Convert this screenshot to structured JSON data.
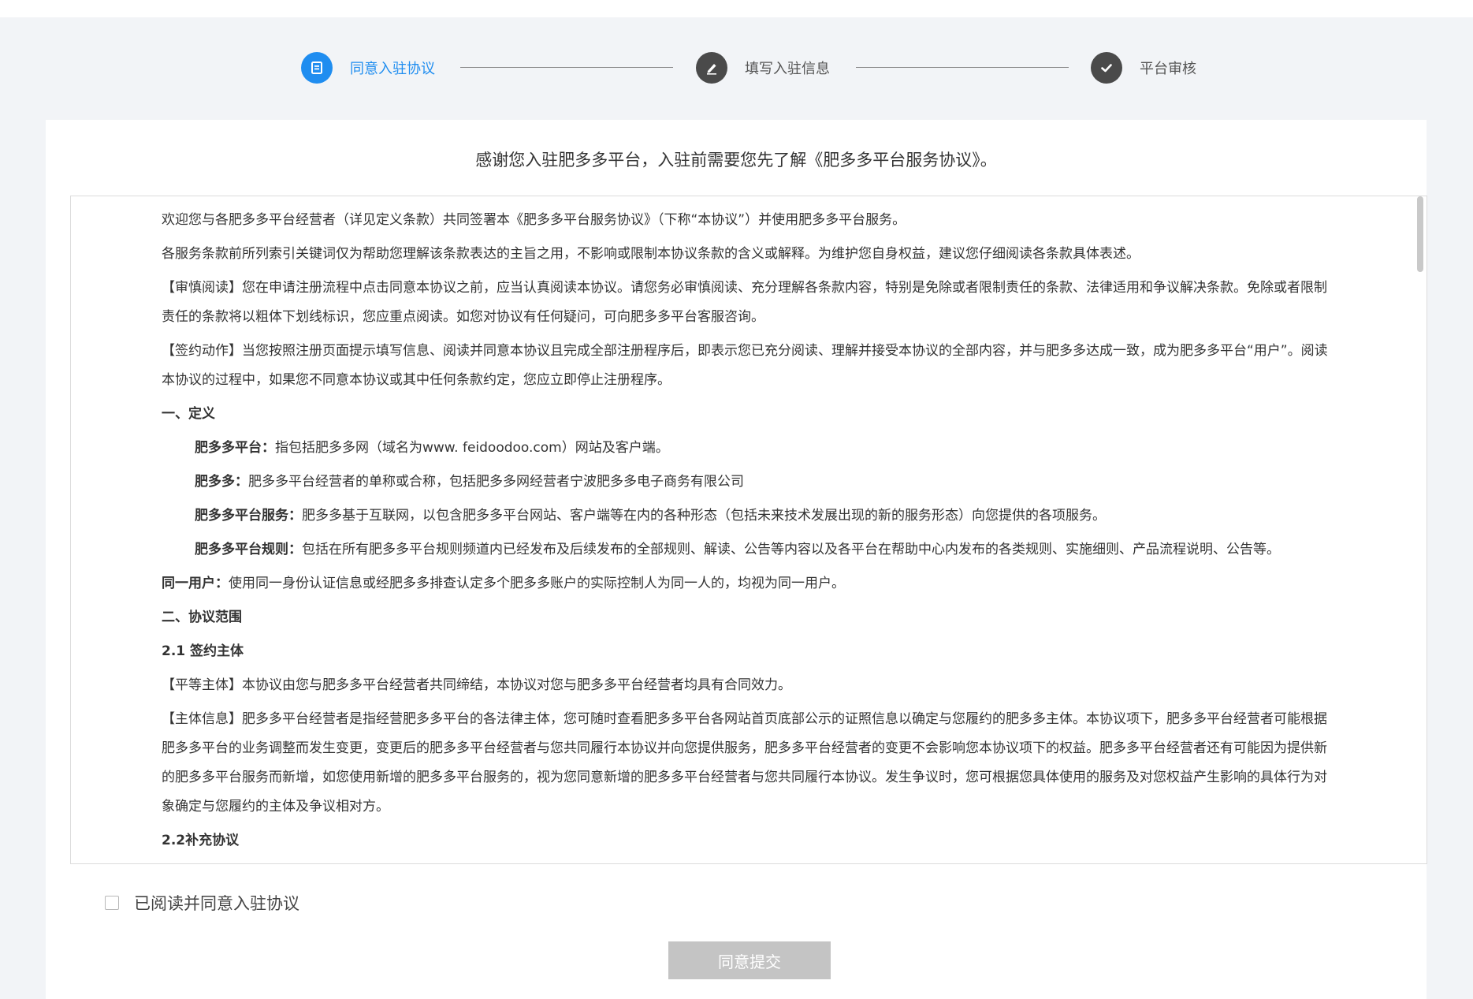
{
  "steps": [
    {
      "label": "同意入驻协议",
      "icon": "document-icon",
      "active": true
    },
    {
      "label": "填写入驻信息",
      "icon": "pencil-icon",
      "active": false
    },
    {
      "label": "平台审核",
      "icon": "check-icon",
      "active": false
    }
  ],
  "colors": {
    "accent": "#1f8df0",
    "inactive_step": "#4a4a4a",
    "button_disabled": "#c4c4c4",
    "background": "#f2f4f7"
  },
  "card": {
    "title": "感谢您入驻肥多多平台，入驻前需要您先了解《肥多多平台服务协议》。"
  },
  "agreement": {
    "p1": "欢迎您与各肥多多平台经营者（详见定义条款）共同签署本《肥多多平台服务协议》（下称“本协议”）并使用肥多多平台服务。",
    "p2": "各服务条款前所列索引关键词仅为帮助您理解该条款表达的主旨之用，不影响或限制本协议条款的含义或解释。为维护您自身权益，建议您仔细阅读各条款具体表述。",
    "p3": "【审慎阅读】您在申请注册流程中点击同意本协议之前，应当认真阅读本协议。请您务必审慎阅读、充分理解各条款内容，特别是免除或者限制责任的条款、法律适用和争议解决条款。免除或者限制责任的条款将以粗体下划线标识，您应重点阅读。如您对协议有任何疑问，可向肥多多平台客服咨询。",
    "p4": "【签约动作】当您按照注册页面提示填写信息、阅读并同意本协议且完成全部注册程序后，即表示您已充分阅读、理解并接受本协议的全部内容，并与肥多多达成一致，成为肥多多平台“用户”。阅读本协议的过程中，如果您不同意本协议或其中任何条款约定，您应立即停止注册程序。",
    "h1": "一、定义",
    "d1_term": "肥多多平台：",
    "d1_text": "指包括肥多多网（域名为www. feidoodoo.com）网站及客户端。",
    "d2_term": "肥多多：",
    "d2_text": "肥多多平台经营者的单称或合称，包括肥多多网经营者宁波肥多多电子商务有限公司",
    "d3_term": "肥多多平台服务：",
    "d3_text": "肥多多基于互联网，以包含肥多多平台网站、客户端等在内的各种形态（包括未来技术发展出现的新的服务形态）向您提供的各项服务。",
    "d4_term": "肥多多平台规则：",
    "d4_text": "包括在所有肥多多平台规则频道内已经发布及后续发布的全部规则、解读、公告等内容以及各平台在帮助中心内发布的各类规则、实施细则、产品流程说明、公告等。",
    "d5_term": "同一用户：",
    "d5_text": "使用同一身份认证信息或经肥多多排查认定多个肥多多账户的实际控制人为同一人的，均视为同一用户。",
    "h2": "二、协议范围",
    "h21": "2.1 签约主体",
    "p5": "【平等主体】本协议由您与肥多多平台经营者共同缔结，本协议对您与肥多多平台经营者均具有合同效力。",
    "p6": "【主体信息】肥多多平台经营者是指经营肥多多平台的各法律主体，您可随时查看肥多多平台各网站首页底部公示的证照信息以确定与您履约的肥多多主体。本协议项下，肥多多平台经营者可能根据肥多多平台的业务调整而发生变更，变更后的肥多多平台经营者与您共同履行本协议并向您提供服务，肥多多平台经营者的变更不会影响您本协议项下的权益。肥多多平台经营者还有可能因为提供新的肥多多平台服务而新增，如您使用新增的肥多多平台服务的，视为您同意新增的肥多多平台经营者与您共同履行本协议。发生争议时，您可根据您具体使用的服务及对您权益产生影响的具体行为对象确定与您履约的主体及争议相对方。",
    "h22": "2.2补充协议"
  },
  "consent": {
    "checkbox_label": "已阅读并同意入驻协议",
    "checked": false
  },
  "submit": {
    "label": "同意提交",
    "enabled": false
  }
}
